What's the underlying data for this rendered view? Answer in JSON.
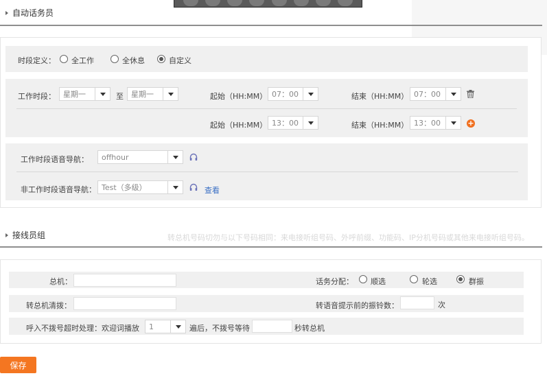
{
  "auto_attendant": {
    "title": "自动话务员",
    "period": {
      "label": "时段定义：",
      "options": [
        "全工作",
        "全休息",
        "自定义"
      ],
      "selected": "自定义"
    },
    "work_time": {
      "label": "工作时段：",
      "day_from": "星期一",
      "to_label": "至",
      "day_to": "星期一",
      "rows": [
        {
          "start_label": "起始（HH:MM）",
          "start": "07：00",
          "end_label": "结束（HH:MM）",
          "end": "07：00"
        },
        {
          "start_label": "起始（HH:MM）",
          "start": "13：00",
          "end_label": "结束（HH:MM）",
          "end": "13：00"
        }
      ]
    },
    "voice_nav": {
      "work_label": "工作时段语音导航：",
      "work_value": "offhour",
      "nonwork_label": "非工作时段语音导航：",
      "nonwork_value": "Test（多级）",
      "view_link": "查看"
    }
  },
  "operator_group": {
    "title": "接线员组",
    "hint": "转总机号码切勿与以下号码相同：来电接听组号码、外呼前缀、功能码、IP分机号码或其他来电接听组号码。",
    "switchboard_label": "总机：",
    "switchboard_value": "",
    "dial_label": "转总机清拨：",
    "dial_value": "",
    "distribution_label": "话务分配：",
    "distribution_options": [
      "顺选",
      "轮选",
      "群振"
    ],
    "distribution_selected": "群振",
    "rings_label": "转语音提示前的振铃数：",
    "rings_value": "",
    "rings_unit": "次",
    "timeout_label": "呼入不拨号超时处理：欢迎词播放",
    "timeout_times": "1",
    "timeout_mid": "遍后，不拨号等待",
    "timeout_value": "",
    "timeout_suffix": "秒转总机"
  },
  "save_label": "保存",
  "colors": {
    "accent": "#f47621",
    "link": "#3a6fc4",
    "panel": "#f0f0f0"
  }
}
